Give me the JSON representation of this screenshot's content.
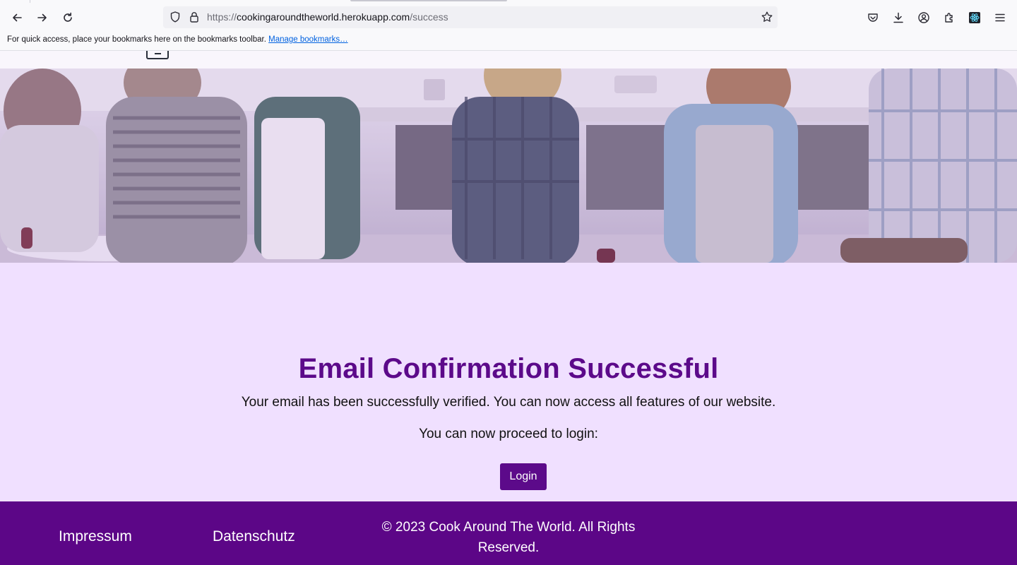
{
  "browser": {
    "url_scheme": "https://",
    "url_host": "cookingaroundtheworld.herokuapp.com",
    "url_path": "/success",
    "bookmarks_message": "For quick access, place your bookmarks here on the bookmarks toolbar.",
    "bookmarks_link": "Manage bookmarks…",
    "icons": [
      "back-icon",
      "forward-icon",
      "reload-icon",
      "shield-icon",
      "lock-icon",
      "star-icon",
      "pocket-icon",
      "download-icon",
      "account-icon",
      "extensions-icon",
      "react-devtools-icon",
      "menu-icon"
    ]
  },
  "main": {
    "title": "Email Confirmation Successful",
    "message": "Your email has been successfully verified. You can now access all features of our website.",
    "proceed_text": "You can now proceed to login:",
    "login_label": "Login"
  },
  "footer": {
    "impressum": "Impressum",
    "datenschutz": "Datenschutz",
    "copyright": "© 2023 Cook Around The World. All Rights Reserved."
  },
  "colors": {
    "accent": "#5c0a8a",
    "footer_bg": "#5c0687",
    "page_bg": "#f0e0ff"
  }
}
